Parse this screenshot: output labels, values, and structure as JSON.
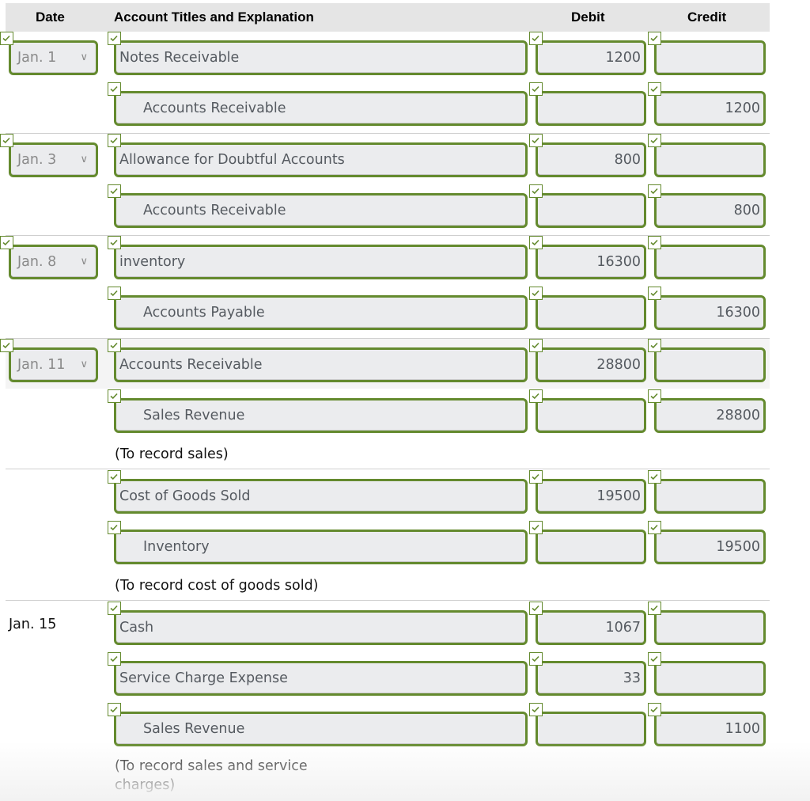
{
  "header": {
    "date": "Date",
    "account": "Account Titles and Explanation",
    "debit": "Debit",
    "credit": "Credit"
  },
  "icons": {
    "check": "check-icon",
    "dropdown": "chevron-down-icon"
  },
  "colors": {
    "field_border": "#648a2e",
    "field_bg": "#ebecee",
    "header_bg": "#e5e5e5"
  },
  "entries": [
    {
      "date": "Jan. 1",
      "date_type": "select",
      "lines": [
        {
          "account": "Notes Receivable",
          "debit": "1200",
          "credit": ""
        },
        {
          "account": "Accounts Receivable",
          "debit": "",
          "credit": "1200"
        }
      ]
    },
    {
      "date": "Jan. 3",
      "date_type": "select",
      "lines": [
        {
          "account": "Allowance for Doubtful Accounts",
          "debit": "800",
          "credit": ""
        },
        {
          "account": "Accounts Receivable",
          "debit": "",
          "credit": "800"
        }
      ]
    },
    {
      "date": "Jan. 8",
      "date_type": "select",
      "lines": [
        {
          "account": "inventory",
          "debit": "16300",
          "credit": ""
        },
        {
          "account": "Accounts Payable",
          "debit": "",
          "credit": "16300"
        }
      ]
    },
    {
      "date": "Jan. 11",
      "date_type": "select",
      "lines": [
        {
          "account": "Accounts Receivable",
          "debit": "28800",
          "credit": ""
        },
        {
          "account": "Sales Revenue",
          "debit": "",
          "credit": "28800"
        }
      ],
      "memo": "(To record sales)"
    },
    {
      "date": "",
      "date_type": "none",
      "lines": [
        {
          "account": "Cost of Goods Sold",
          "debit": "19500",
          "credit": ""
        },
        {
          "account": "Inventory",
          "debit": "",
          "credit": "19500"
        }
      ],
      "memo": "(To record cost of goods sold)"
    },
    {
      "date": "Jan. 15",
      "date_type": "static",
      "lines": [
        {
          "account": "Cash",
          "debit": "1067",
          "credit": ""
        },
        {
          "account": "Service Charge Expense",
          "debit": "33",
          "credit": ""
        },
        {
          "account": "Sales Revenue",
          "debit": "",
          "credit": "1100"
        }
      ],
      "memo_line1": "(To record sales and service",
      "memo_line2": "charges)"
    }
  ]
}
